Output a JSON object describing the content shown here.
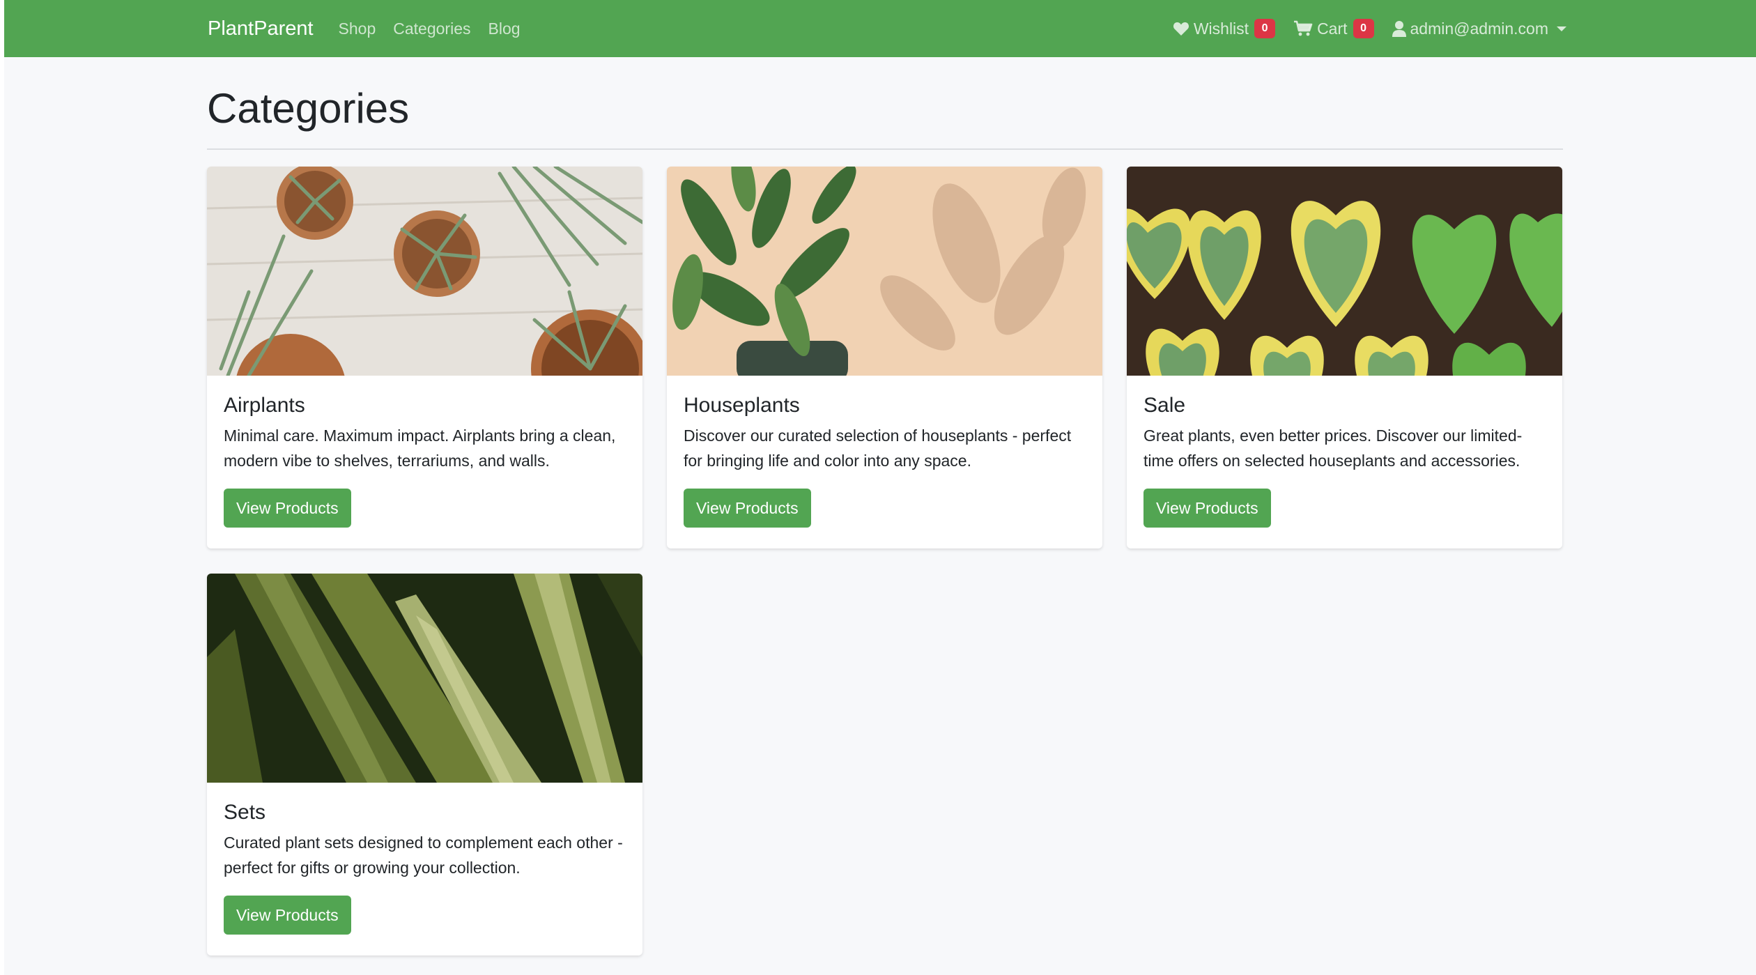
{
  "navbar": {
    "brand": "PlantParent",
    "links": [
      "Shop",
      "Categories",
      "Blog"
    ],
    "wishlist_label": "Wishlist",
    "wishlist_count": "0",
    "cart_label": "Cart",
    "cart_count": "0",
    "user_email": "admin@admin.com",
    "color": "#52a552"
  },
  "page": {
    "title": "Categories"
  },
  "categories": [
    {
      "title": "Airplants",
      "description": "Minimal care. Maximum impact. Airplants bring a clean, modern vibe to shelves, terrariums, and walls.",
      "button": "View Products"
    },
    {
      "title": "Houseplants",
      "description": "Discover our curated selection of houseplants - perfect for bringing life and color into any space.",
      "button": "View Products"
    },
    {
      "title": "Sale",
      "description": "Great plants, even better prices. Discover our limited-time offers on selected houseplants and accessories.",
      "button": "View Products"
    },
    {
      "title": "Sets",
      "description": "Curated plant sets designed to complement each other - perfect for gifts or growing your collection.",
      "button": "View Products"
    }
  ],
  "icons": {
    "wishlist": "heart-icon",
    "cart": "cart-icon",
    "user": "user-icon",
    "dropdown": "caret-down-icon"
  }
}
